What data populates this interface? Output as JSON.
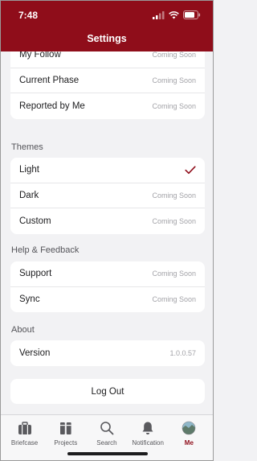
{
  "status_bar": {
    "time": "7:48"
  },
  "header": {
    "title": "Settings"
  },
  "general": {
    "items": [
      {
        "label": "My Follow",
        "value": "Coming Soon"
      },
      {
        "label": "Current Phase",
        "value": "Coming Soon"
      },
      {
        "label": "Reported by Me",
        "value": "Coming Soon"
      }
    ]
  },
  "themes": {
    "heading": "Themes",
    "items": [
      {
        "label": "Light",
        "value": ""
      },
      {
        "label": "Dark",
        "value": "Coming Soon"
      },
      {
        "label": "Custom",
        "value": "Coming Soon"
      }
    ],
    "selected": "Light"
  },
  "help": {
    "heading": "Help & Feedback",
    "items": [
      {
        "label": "Support",
        "value": "Coming Soon"
      },
      {
        "label": "Sync",
        "value": "Coming Soon"
      }
    ]
  },
  "about": {
    "heading": "About",
    "items": [
      {
        "label": "Version",
        "value": "1.0.0.57"
      }
    ]
  },
  "logout_label": "Log Out",
  "tabbar": {
    "items": [
      {
        "label": "Briefcase",
        "icon": "briefcase-icon"
      },
      {
        "label": "Projects",
        "icon": "projects-icon"
      },
      {
        "label": "Search",
        "icon": "search-icon"
      },
      {
        "label": "Notification",
        "icon": "bell-icon"
      },
      {
        "label": "Me",
        "icon": "avatar"
      }
    ],
    "active": "Me"
  },
  "colors": {
    "brand": "#8f0d1a",
    "secondary_text": "#a3a3a8",
    "background": "#f2f2f4"
  }
}
